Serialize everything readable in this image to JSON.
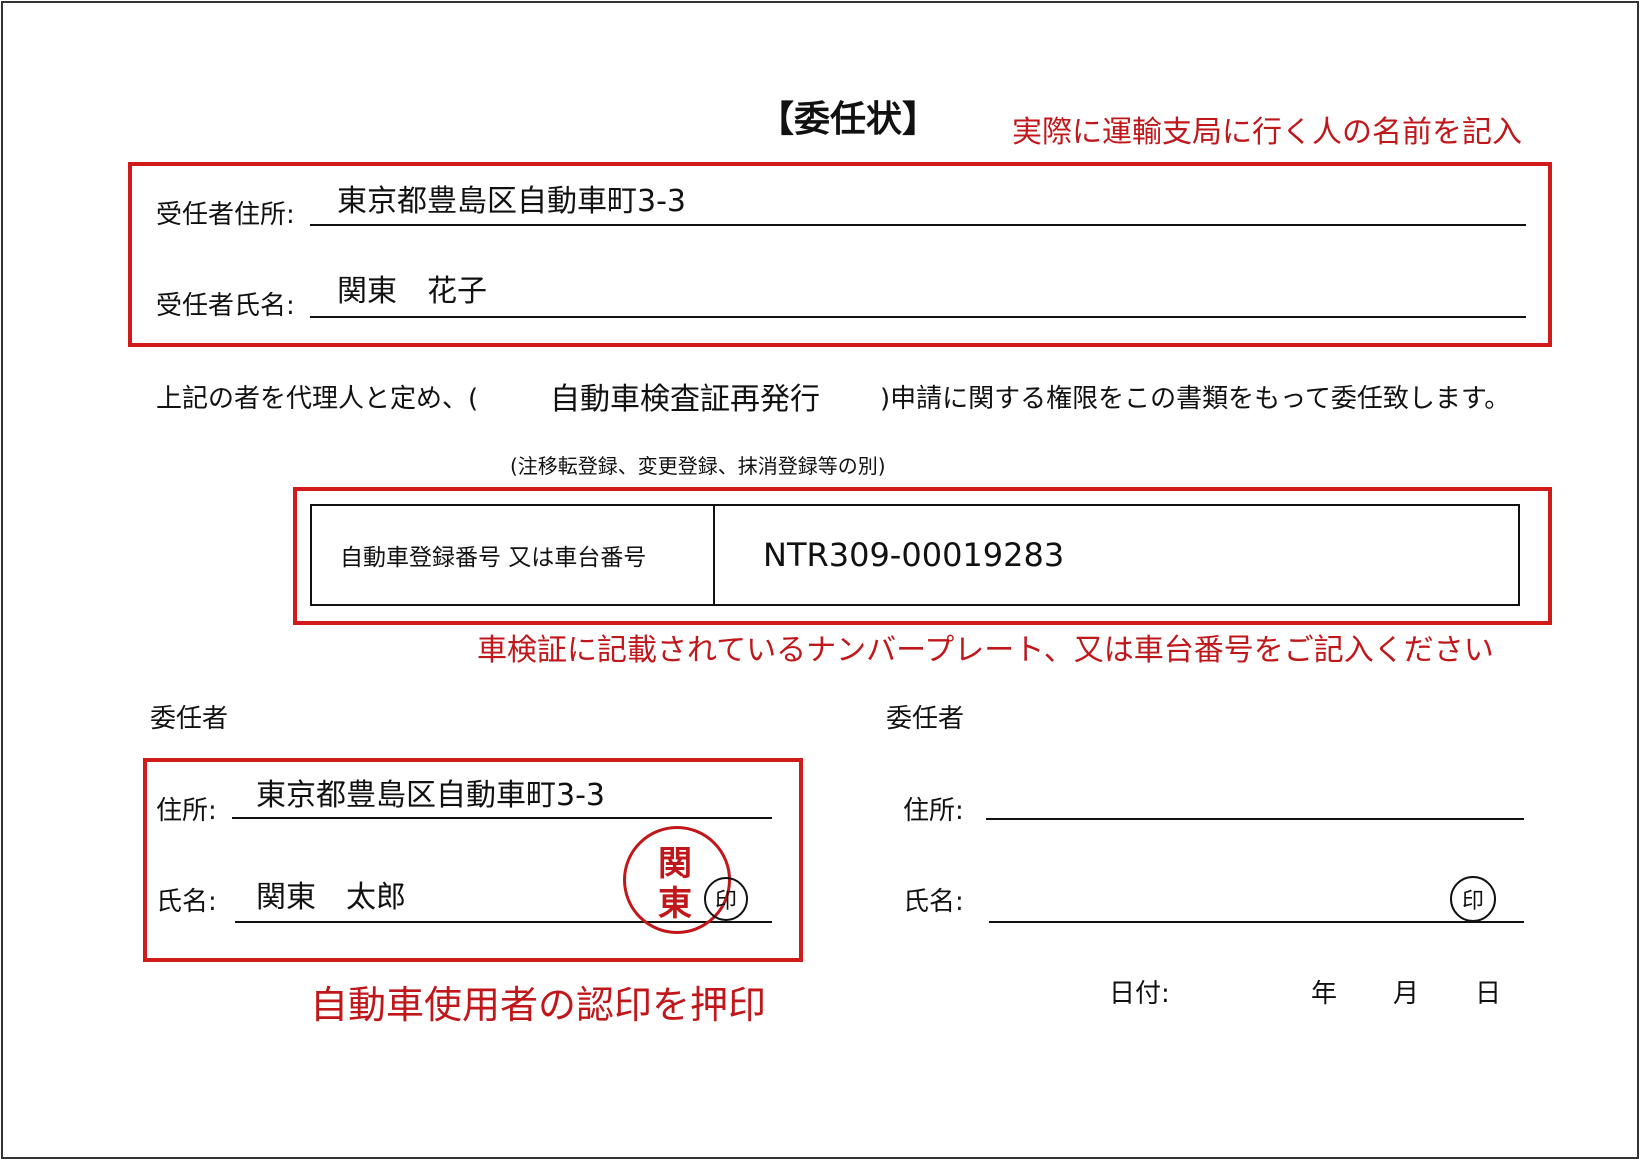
{
  "document": {
    "title": "【委任状】",
    "note_top": "実際に運輸支局に行く人の名前を記入",
    "proxy": {
      "address_label": "受任者住所:",
      "address_value": "東京都豊島区自動車町3-3",
      "name_label": "受任者氏名:",
      "name_value": "関東　花子"
    },
    "statement": {
      "prefix": "上記の者を代理人と定め、(",
      "application": "自動車検査証再発行",
      "suffix": ")申請に関する権限をこの書類をもって委任致します。",
      "hint": "(注移転登録、変更登録、抹消登録等の別)"
    },
    "registration": {
      "label": "自動車登録番号  又は車台番号",
      "value": "NTR309-00019283"
    },
    "note_middle": "車検証に記載されているナンバープレート、又は車台番号をご記入ください",
    "delegator_left": {
      "heading": "委任者",
      "address_label": "住所:",
      "address_value": "東京都豊島区自動車町3-3",
      "name_label": "氏名:",
      "name_value": "関東　太郎",
      "seal_text": [
        "関",
        "東"
      ],
      "seal_mark": "印"
    },
    "note_bottom": "自動車使用者の認印を押印",
    "delegator_right": {
      "heading": "委任者",
      "address_label": "住所:",
      "name_label": "氏名:",
      "seal_mark": "印"
    },
    "date": {
      "label": "日付:",
      "year": "年",
      "month": "月",
      "day": "日"
    }
  },
  "colors": {
    "accent_red": "#d21a1a",
    "note_red": "#c0171b",
    "ink": "#111111"
  }
}
